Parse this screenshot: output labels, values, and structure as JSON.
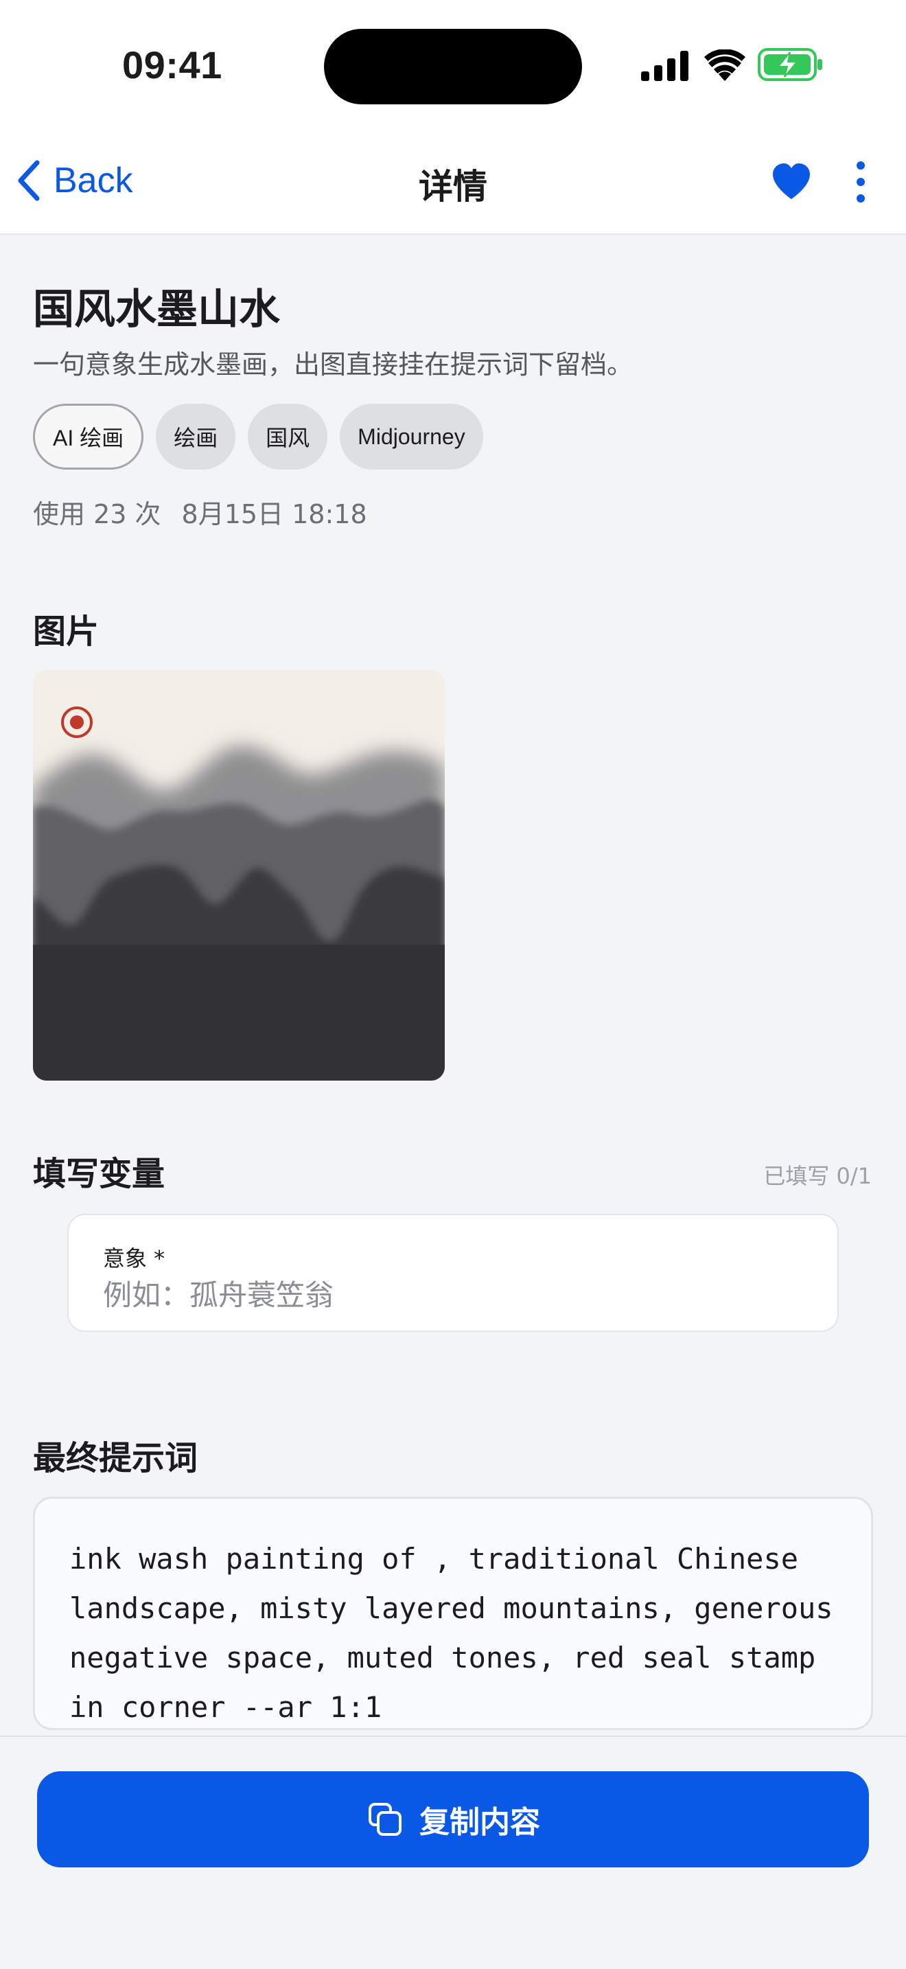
{
  "status_bar": {
    "time": "09:41"
  },
  "nav": {
    "back_label": "Back",
    "title": "详情",
    "favorited": true
  },
  "prompt": {
    "title": "国风水墨山水",
    "description": "一句意象生成水墨画，出图直接挂在提示词下留档。",
    "tags": [
      "AI 绘画",
      "绘画",
      "国风",
      "Midjourney"
    ],
    "usage": "使用 23 次",
    "date": "8月15日 18:18"
  },
  "images_section": {
    "title": "图片"
  },
  "variables_section": {
    "title": "填写变量",
    "fill_status": "已填写 0/1",
    "field_label": "意象 *",
    "field_value": "",
    "field_placeholder": "例如：孤舟蓑笠翁"
  },
  "final_prompt": {
    "title": "最终提示词",
    "text": "ink wash painting of , traditional Chinese landscape, misty layered mountains, generous negative space, muted tones, red seal stamp in corner --ar 1:1"
  },
  "actions": {
    "copy_label": "复制内容"
  },
  "colors": {
    "accent": "#0a58e6",
    "background": "#f3f4f6",
    "seal_red": "#c0392b",
    "battery_green": "#34c759"
  },
  "icons": {
    "back": "chevron-left-icon",
    "favorite": "heart-icon",
    "more": "more-vertical-icon",
    "copy": "copy-icon"
  }
}
